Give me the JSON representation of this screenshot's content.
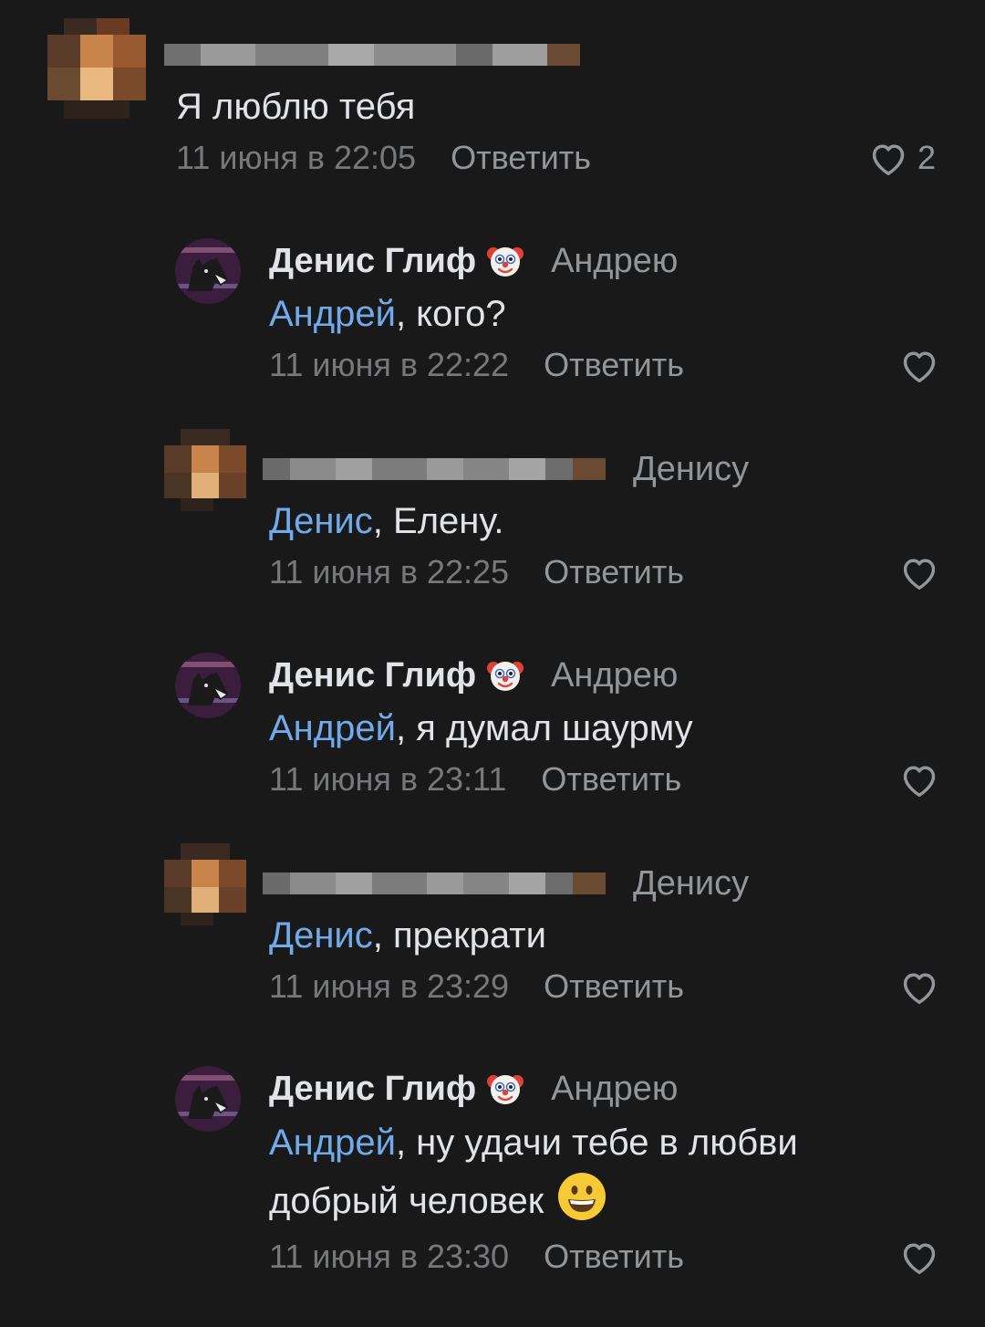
{
  "comments": [
    {
      "author": "",
      "text_mention": "",
      "text_rest": "Я люблю тебя",
      "date": "11 июня в 22:05",
      "reply_label": "Ответить",
      "likes": "2"
    },
    {
      "author": "Денис Глиф",
      "reply_to": "Андрею",
      "text_mention": "Андрей",
      "text_rest": ", кого?",
      "date": "11 июня в 22:22",
      "reply_label": "Ответить"
    },
    {
      "author": "",
      "reply_to": "Денису",
      "text_mention": "Денис",
      "text_rest": ", Елену.",
      "date": "11 июня в 22:25",
      "reply_label": "Ответить"
    },
    {
      "author": "Денис Глиф",
      "reply_to": "Андрею",
      "text_mention": "Андрей",
      "text_rest": ", я думал шаурму",
      "date": "11 июня в 23:11",
      "reply_label": "Ответить"
    },
    {
      "author": "",
      "reply_to": "Денису",
      "text_mention": "Денис",
      "text_rest": ", прекрати",
      "date": "11 июня в 23:29",
      "reply_label": "Ответить"
    },
    {
      "author": "Денис Глиф",
      "reply_to": "Андрею",
      "text_mention": "Андрей",
      "text_rest": ", ну удачи тебе в любви",
      "text_line2": "добрый человек",
      "date": "11 июня в 23:30",
      "reply_label": "Ответить"
    }
  ],
  "icons": {
    "like": "heart-outline-icon",
    "clown": "clown-emoji-icon",
    "smile": "grinning-emoji-icon"
  },
  "colors": {
    "background": "#19191a",
    "text": "#e1e3e6",
    "mention": "#71aaeb",
    "secondary": "#939699"
  }
}
